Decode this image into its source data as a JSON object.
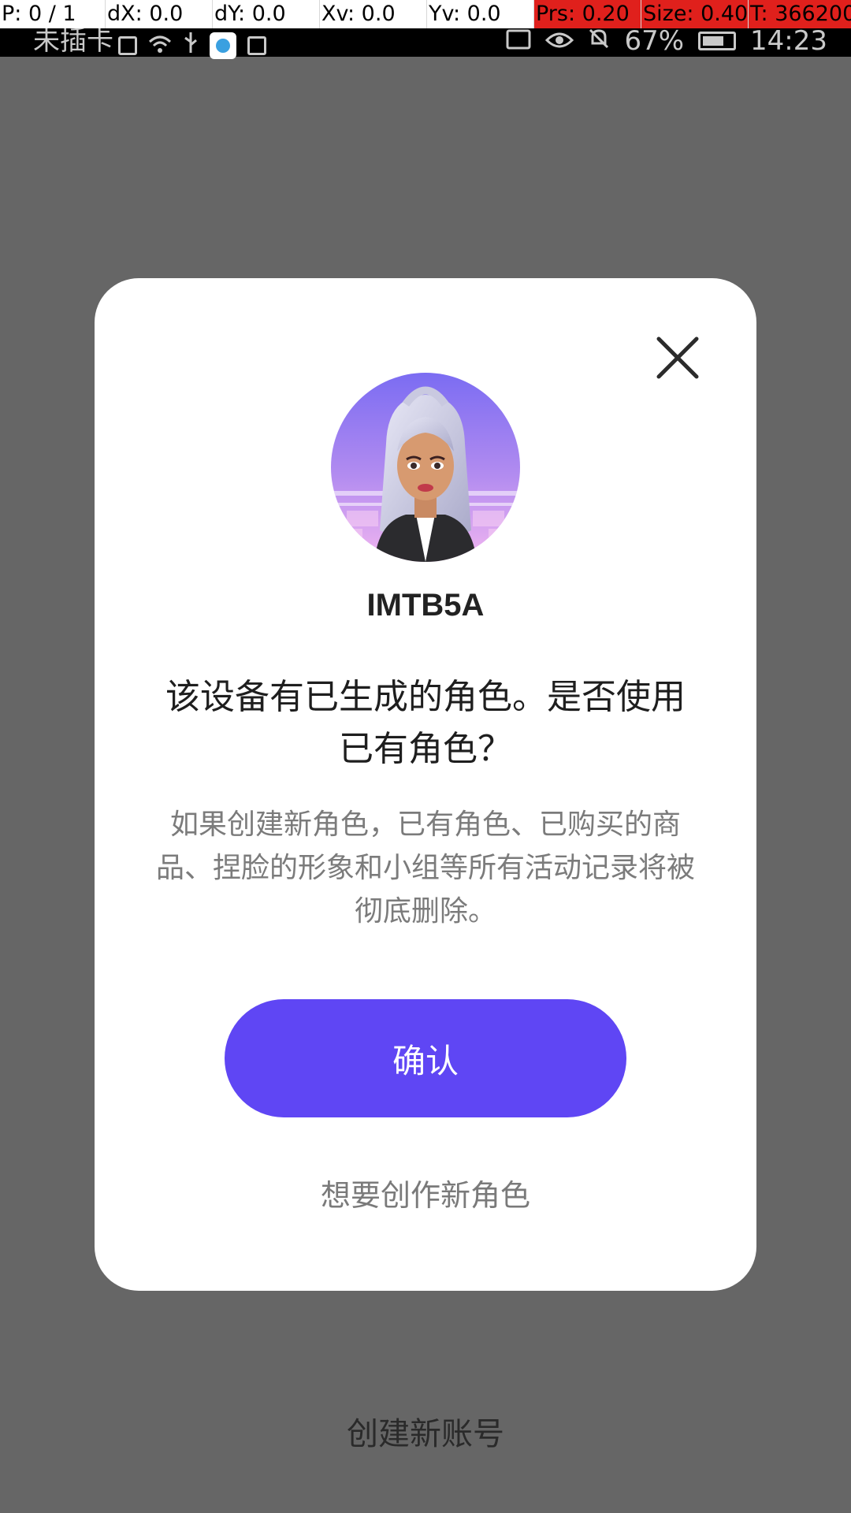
{
  "debug_overlay": {
    "pointer": "P: 0 / 1",
    "dx": "dX: 0.0",
    "dy": "dY: 0.0",
    "xv": "Xv: 0.0",
    "yv": "Yv: 0.0",
    "prs": "Prs: 0.20",
    "size": "Size: 0.40",
    "t": "T: 366200",
    "alert_color": "#e0201c"
  },
  "status_bar": {
    "carrier": "未插卡",
    "battery": "67%",
    "time": "14:23",
    "icons": [
      "sim-icon",
      "wifi-icon",
      "usb-icon",
      "app-notification-icon",
      "media-icon",
      "cast-icon",
      "eye-icon",
      "mute-icon",
      "battery-icon"
    ]
  },
  "dialog": {
    "username": "IMTB5A",
    "headline": "该设备有已生成的角色。是否使用已有角色？",
    "description": "如果创建新角色，已有角色、已购买的商品、捏脸的形象和小组等所有活动记录将被彻底删除。",
    "confirm_label": "确认",
    "create_new_character_label": "想要创作新角色",
    "close_icon": "close-icon",
    "accent_color": "#5f46f4"
  },
  "footer": {
    "create_account_label": "创建新账号"
  }
}
